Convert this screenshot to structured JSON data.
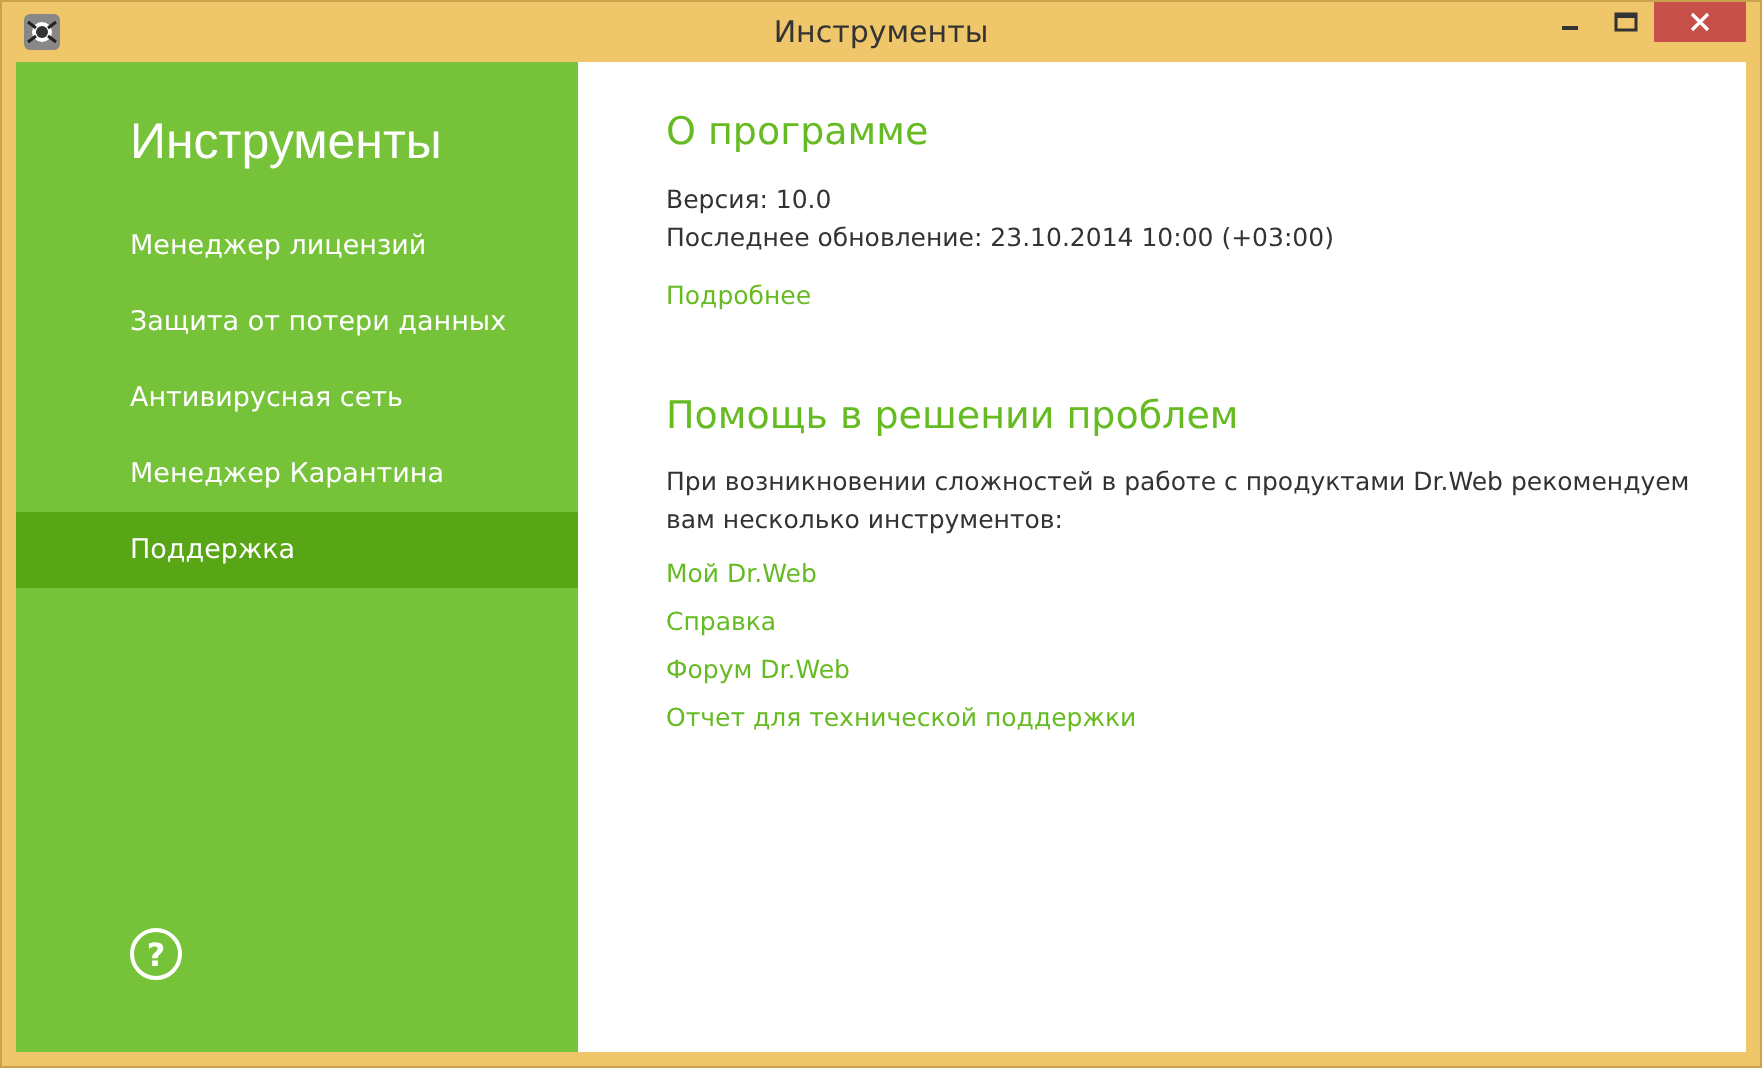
{
  "window": {
    "title": "Инструменты"
  },
  "sidebar": {
    "title": "Инструменты",
    "items": [
      {
        "label": "Менеджер лицензий",
        "selected": false
      },
      {
        "label": "Защита от потери данных",
        "selected": false
      },
      {
        "label": "Антивирусная сеть",
        "selected": false
      },
      {
        "label": "Менеджер Карантина",
        "selected": false
      },
      {
        "label": "Поддержка",
        "selected": true
      }
    ],
    "help_button": "?"
  },
  "about": {
    "heading": "О программе",
    "version": "Версия: 10.0",
    "last_update": "Последнее обновление: 23.10.2014 10:00 (+03:00)",
    "more_link": "Подробнее"
  },
  "help": {
    "heading": "Помощь в решении проблем",
    "description": "При возникновении сложностей в работе с продуктами Dr.Web рекомендуем вам несколько инструментов:",
    "links": [
      "Мой Dr.Web",
      "Справка",
      "Форум Dr.Web",
      "Отчет для технической поддержки"
    ]
  }
}
